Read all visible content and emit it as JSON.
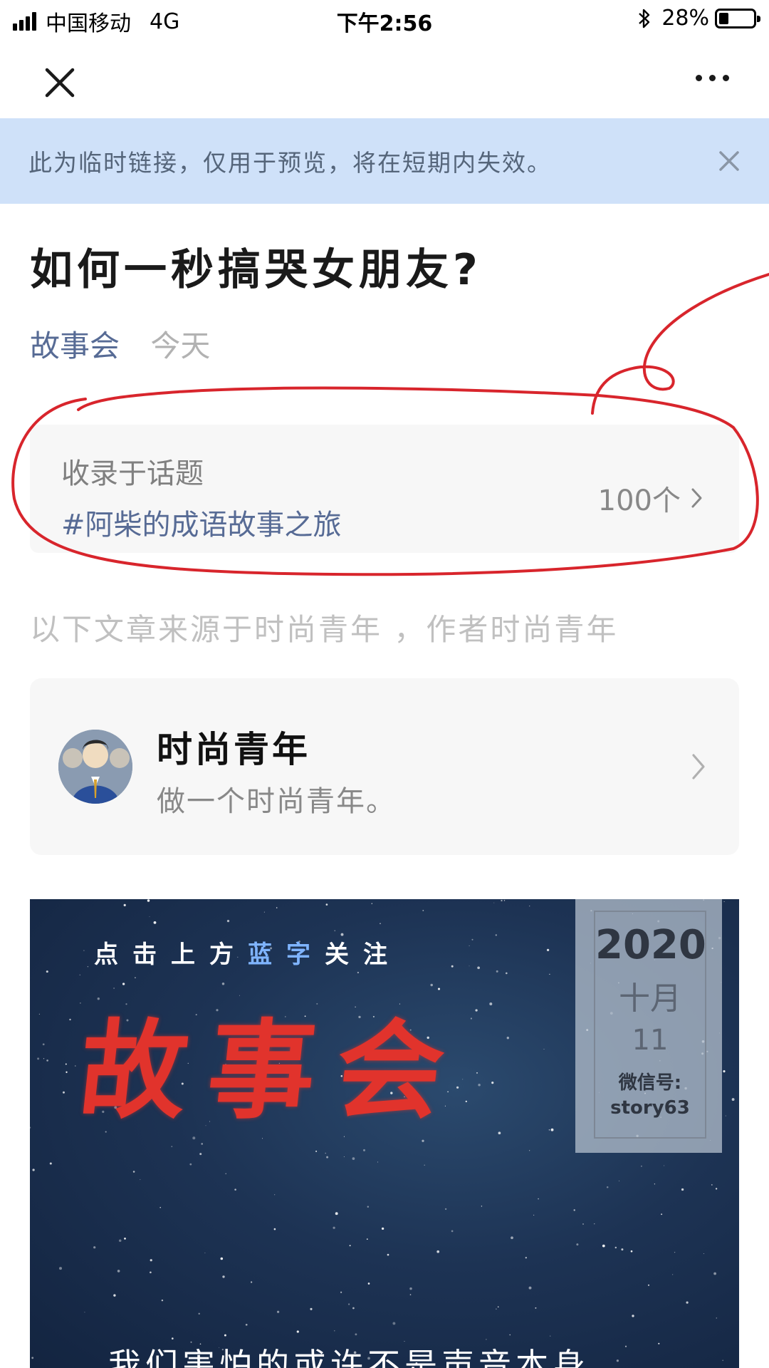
{
  "status_bar": {
    "carrier": "中国移动",
    "network": "4G",
    "time": "下午2:56",
    "battery": "28%",
    "battery_level": 0.28
  },
  "nav": {
    "close_icon": "close-icon",
    "more_icon": "more-icon"
  },
  "notice": {
    "text": "此为临时链接，仅用于预览，将在短期内失效。"
  },
  "article": {
    "title": "如何一秒搞哭女朋友?",
    "author": "故事会",
    "date": "今天"
  },
  "topic": {
    "label": "收录于话题",
    "name": "#阿柴的成语故事之旅",
    "count": "100个"
  },
  "source_line": "以下文章来源于时尚青年 ，作者时尚青年",
  "account": {
    "name": "时尚青年",
    "description": "做一个时尚青年。"
  },
  "cover": {
    "follow_prefix": "点击上方",
    "follow_blue": "蓝字",
    "follow_suffix": "关注",
    "brand": "故事会",
    "year": "2020",
    "month": "十月",
    "day": "11",
    "wechat_label": "微信号:",
    "wechat_id": "story63",
    "caption": "我们害怕的或许不是声音本身"
  },
  "colors": {
    "link_blue": "#576b95",
    "notice_bg": "#cfe1f9",
    "annotation_red": "#d8252c",
    "brand_red": "#e1332c"
  }
}
